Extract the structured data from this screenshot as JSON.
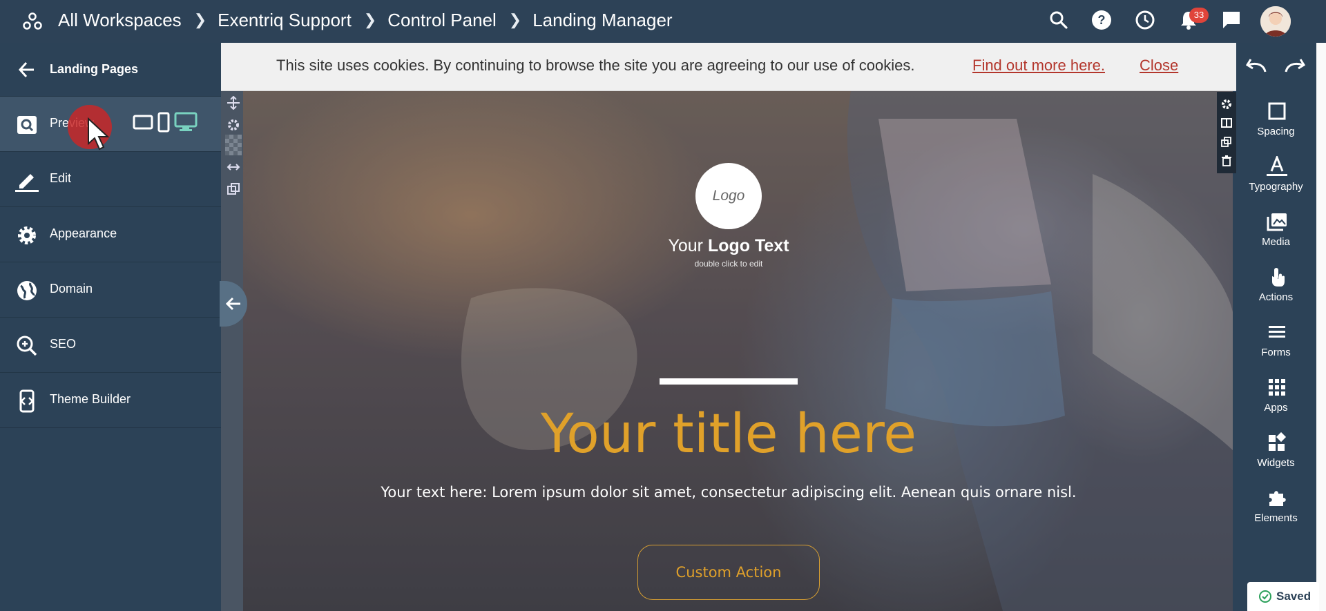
{
  "topbar": {
    "breadcrumbs": [
      "All Workspaces",
      "Exentriq Support",
      "Control Panel",
      "Landing Manager"
    ],
    "notification_count": "33",
    "icons": [
      "workspaces-icon",
      "search-icon",
      "help-icon",
      "history-icon",
      "bell-icon",
      "chat-icon",
      "avatar"
    ]
  },
  "sidebar": {
    "back_label": "Landing Pages",
    "items": [
      {
        "label": "Preview",
        "icon": "preview-icon"
      },
      {
        "label": "Edit",
        "icon": "edit-icon"
      },
      {
        "label": "Appearance",
        "icon": "gear-icon"
      },
      {
        "label": "Domain",
        "icon": "globe-icon"
      },
      {
        "label": "SEO",
        "icon": "seo-search-icon"
      },
      {
        "label": "Theme Builder",
        "icon": "theme-builder-icon"
      }
    ],
    "devices": [
      "tablet-icon",
      "mobile-icon",
      "desktop-icon"
    ],
    "accent": "#79d2c0"
  },
  "cookie_bar": {
    "text": "This site uses cookies. By continuing to browse the site you are agreeing to our use of cookies.",
    "link": "Find out more here.",
    "close": "Close"
  },
  "hero": {
    "logo_placeholder": "Logo",
    "logo_text_light": "Your",
    "logo_text_bold": "Logo Text",
    "logo_hint": "double click to edit",
    "title": "Your title here",
    "text": "Your text here: Lorem ipsum dolor sit amet, consectetur adipiscing elit. Aenean quis ornare nisl.",
    "button": "Custom Action",
    "title_color": "#e0a12a"
  },
  "tools": [
    {
      "label": "Spacing",
      "icon": "spacing-icon"
    },
    {
      "label": "Typography",
      "icon": "typography-icon"
    },
    {
      "label": "Media",
      "icon": "media-icon"
    },
    {
      "label": "Actions",
      "icon": "touch-icon"
    },
    {
      "label": "Forms",
      "icon": "forms-icon"
    },
    {
      "label": "Apps",
      "icon": "apps-icon"
    },
    {
      "label": "Widgets",
      "icon": "widgets-icon"
    },
    {
      "label": "Elements",
      "icon": "puzzle-icon"
    }
  ],
  "status": {
    "saved": "Saved"
  }
}
